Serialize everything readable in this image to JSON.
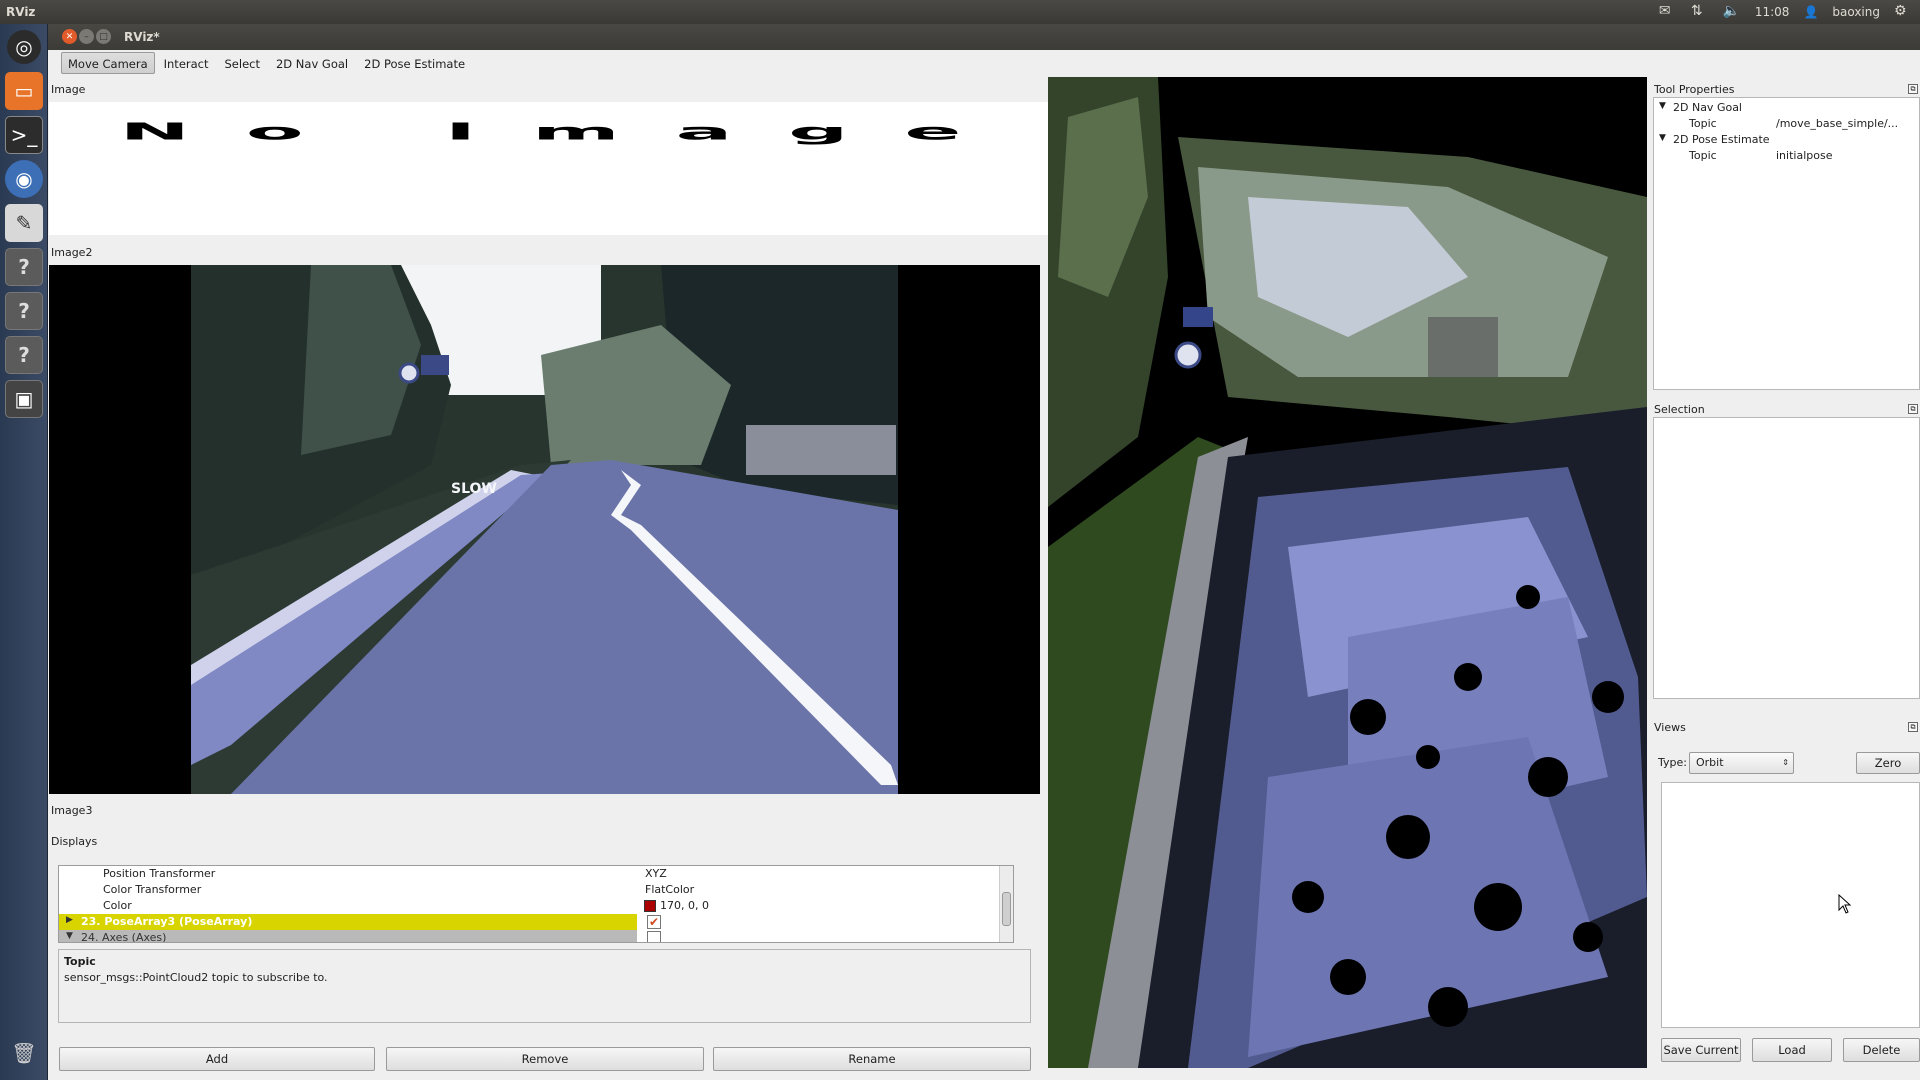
{
  "system": {
    "app_name": "RViz",
    "time": "11:08",
    "user": "baoxing"
  },
  "window": {
    "title": "RViz*"
  },
  "toolbar": {
    "tools": [
      "Move Camera",
      "Interact",
      "Select",
      "2D Nav Goal",
      "2D Pose Estimate"
    ],
    "active_tool": "Move Camera"
  },
  "panels": {
    "image1": {
      "title": "Image",
      "placeholder_text": "No Image"
    },
    "image2": {
      "title": "Image2",
      "road_text": "SLOW"
    },
    "image3": {
      "title": "Image3"
    },
    "displays": {
      "title": "Displays",
      "rows": [
        {
          "name": "Position Transformer",
          "value": "XYZ"
        },
        {
          "name": "Color Transformer",
          "value": "FlatColor"
        },
        {
          "name": "Color",
          "value": "170, 0, 0"
        },
        {
          "name": "23. PoseArray3 (PoseArray)",
          "value": "",
          "checked": true
        },
        {
          "name": "24. Axes (Axes)",
          "value": "",
          "checked": false
        }
      ],
      "help_title": "Topic",
      "help_text": "sensor_msgs::PointCloud2 topic to subscribe to.",
      "buttons": {
        "add": "Add",
        "remove": "Remove",
        "rename": "Rename"
      }
    },
    "tool_properties": {
      "title": "Tool Properties",
      "items": [
        {
          "group": "2D Nav Goal",
          "key": "Topic",
          "value": "/move_base_simple/..."
        },
        {
          "group": "2D Pose Estimate",
          "key": "Topic",
          "value": "initialpose"
        }
      ]
    },
    "selection": {
      "title": "Selection"
    },
    "views": {
      "title": "Views",
      "type_label": "Type:",
      "type_value": "Orbit",
      "zero_label": "Zero",
      "buttons": {
        "save": "Save Current",
        "load": "Load",
        "delete": "Delete"
      }
    }
  },
  "colors": {
    "selected_row": "#d8d400",
    "color_swatch": "#aa0000",
    "road": "#6a74a8",
    "launcher": "#2f405a"
  }
}
